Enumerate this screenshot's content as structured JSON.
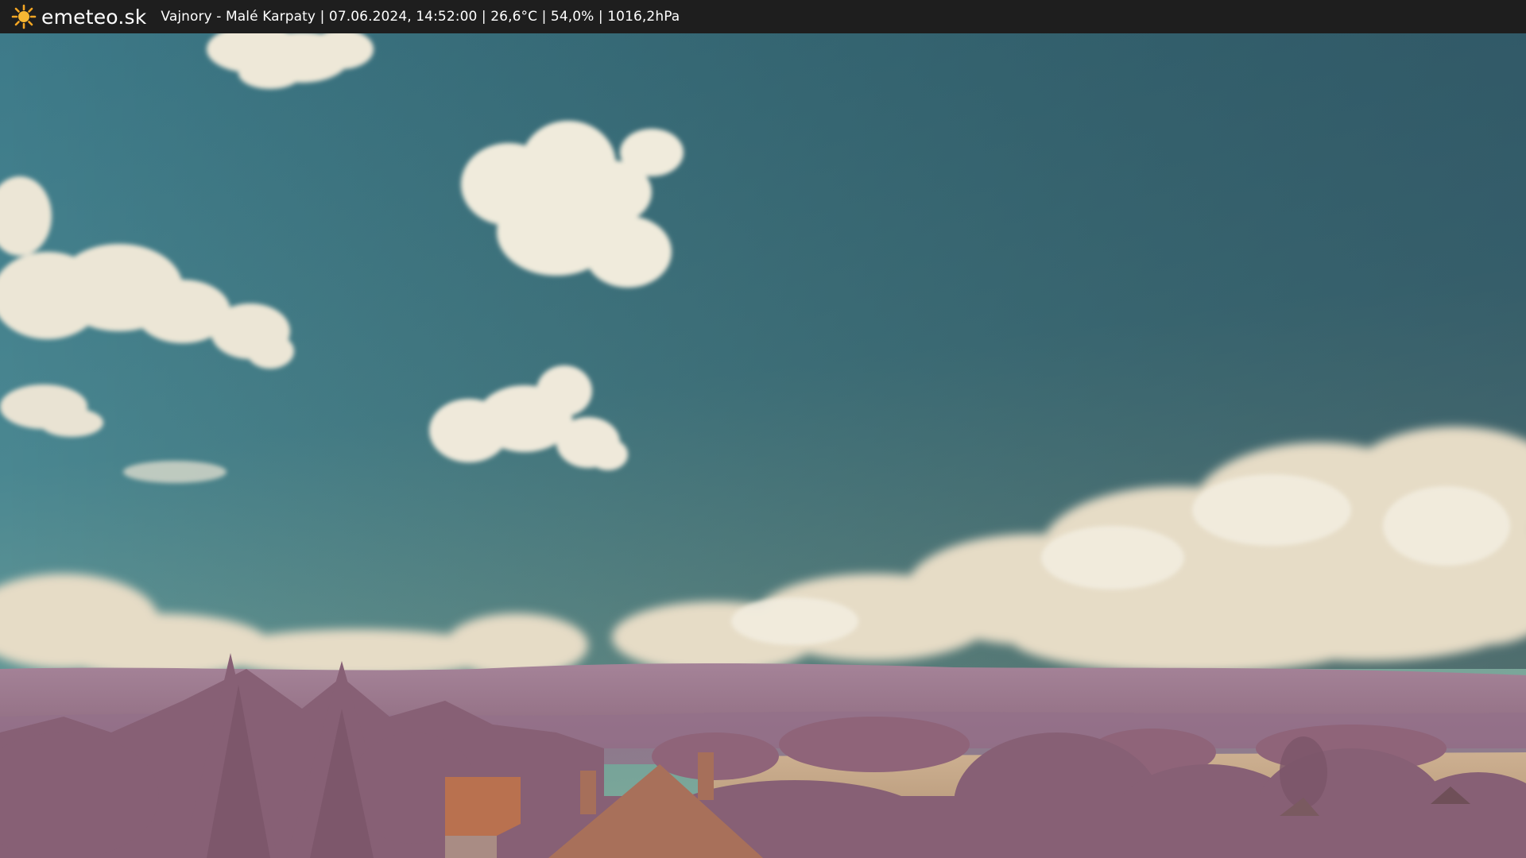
{
  "header": {
    "brand": "emeteo.sk",
    "caption": "Vajnory - Malé Karpaty | 07.06.2024, 14:52:00 | 26,6°C | 54,0% | 1016,2hPa",
    "icon": "sun-icon"
  },
  "colors": {
    "bar": "#1e1e1e",
    "sun": "#f5a623",
    "sky_top": "#3c5f72",
    "sky_mid": "#4a8590",
    "sky_horizon": "#7da59b",
    "cloud": "#eee8d8",
    "hills": "#a37f92",
    "foliage": "#95697f",
    "field": "#c7a887",
    "roof": "#b86f55"
  }
}
